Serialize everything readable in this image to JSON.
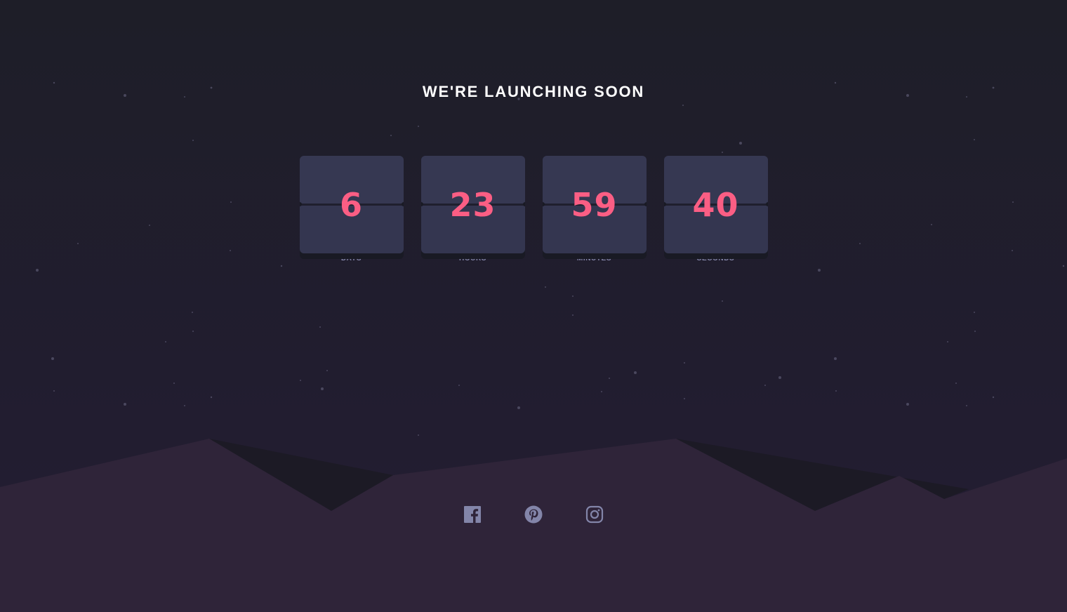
{
  "page": {
    "title": "WE'RE LAUNCHING SOON"
  },
  "countdown": [
    {
      "value": "6",
      "unit": "DAYS"
    },
    {
      "value": "23",
      "unit": "HOURS"
    },
    {
      "value": "59",
      "unit": "MINUTES"
    },
    {
      "value": "40",
      "unit": "SECONDS"
    }
  ],
  "social_links": [
    {
      "icon": "facebook-icon"
    },
    {
      "icon": "pinterest-icon"
    },
    {
      "icon": "instagram-icon"
    }
  ],
  "colors": {
    "background": "#1e1e28",
    "card": "#343650",
    "number": "#fb5e84",
    "label": "#8486a9",
    "hills": "#2f2439",
    "icon": "#8385a9"
  }
}
